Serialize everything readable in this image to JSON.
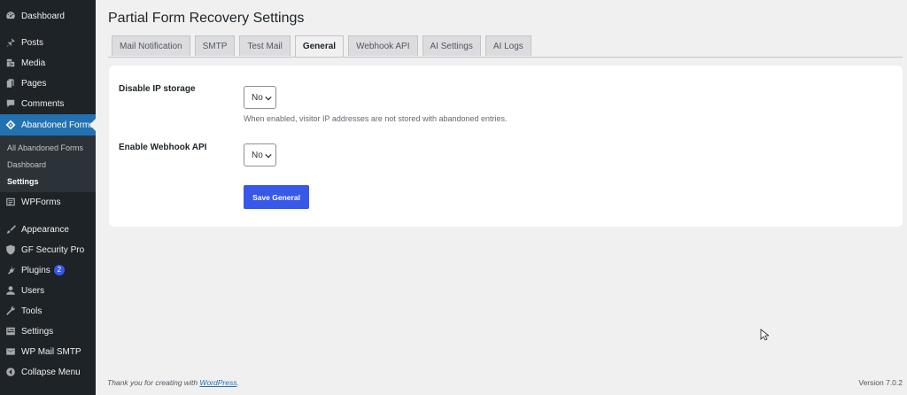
{
  "sidebar": {
    "items": [
      {
        "label": "Dashboard",
        "icon": "dashboard-icon"
      },
      {
        "label": "Posts",
        "icon": "pin-icon"
      },
      {
        "label": "Media",
        "icon": "media-icon"
      },
      {
        "label": "Pages",
        "icon": "pages-icon"
      },
      {
        "label": "Comments",
        "icon": "comment-icon"
      },
      {
        "label": "Abandoned Forms",
        "icon": "forms-icon"
      },
      {
        "label": "WPForms",
        "icon": "wpforms-icon"
      },
      {
        "label": "Appearance",
        "icon": "brush-icon"
      },
      {
        "label": "GF Security Pro",
        "icon": "shield-icon"
      },
      {
        "label": "Plugins",
        "icon": "plugin-icon",
        "badge": "2"
      },
      {
        "label": "Users",
        "icon": "user-icon"
      },
      {
        "label": "Tools",
        "icon": "wrench-icon"
      },
      {
        "label": "Settings",
        "icon": "settings-icon"
      },
      {
        "label": "WP Mail SMTP",
        "icon": "mail-icon"
      },
      {
        "label": "Collapse Menu",
        "icon": "collapse-icon"
      }
    ],
    "submenu": [
      {
        "label": "All Abandoned Forms"
      },
      {
        "label": "Dashboard"
      },
      {
        "label": "Settings"
      }
    ]
  },
  "page": {
    "title": "Partial Form Recovery Settings"
  },
  "tabs": [
    {
      "label": "Mail Notification"
    },
    {
      "label": "SMTP"
    },
    {
      "label": "Test Mail"
    },
    {
      "label": "General"
    },
    {
      "label": "Webhook API"
    },
    {
      "label": "AI Settings"
    },
    {
      "label": "AI Logs"
    }
  ],
  "form": {
    "disable_ip": {
      "label": "Disable IP storage",
      "value": "No",
      "description": "When enabled, visitor IP addresses are not stored with abandoned entries."
    },
    "webhook": {
      "label": "Enable Webhook API",
      "value": "No"
    },
    "save_label": "Save General"
  },
  "footer": {
    "thanks": "Thank you for creating with ",
    "link": "WordPress",
    "period": ".",
    "version": "Version 7.0.2"
  },
  "colors": {
    "sidebar_bg": "#1d2327",
    "active_menu": "#2271b1",
    "primary_button": "#3858e9",
    "page_bg": "#f0f0f1"
  }
}
